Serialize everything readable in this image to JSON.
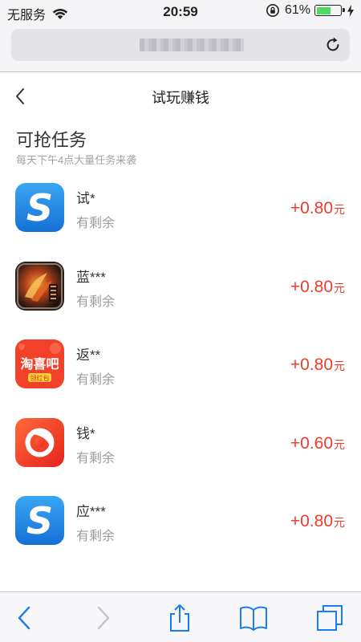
{
  "status_bar": {
    "carrier": "无服务",
    "time": "20:59",
    "battery_percent": "61%",
    "battery_level": 0.61
  },
  "browser": {
    "url": "",
    "reload_icon": "reload-icon"
  },
  "header": {
    "title": "试玩赚钱",
    "back_icon": "chevron-left-icon"
  },
  "section": {
    "title": "可抢任务",
    "subtitle": "每天下午4点大量任务来袭"
  },
  "tasks": [
    {
      "name": "试*",
      "remain": "有剩余",
      "reward": "+0.80",
      "unit": "元",
      "icon": "blue-s-app-icon"
    },
    {
      "name": "蓝***",
      "remain": "有剩余",
      "reward": "+0.80",
      "unit": "元",
      "icon": "game-app-icon"
    },
    {
      "name": "返**",
      "remain": "有剩余",
      "reward": "+0.80",
      "unit": "元",
      "icon": "taoxiba-app-icon"
    },
    {
      "name": "钱*",
      "remain": "有剩余",
      "reward": "+0.60",
      "unit": "元",
      "icon": "red-swirl-app-icon"
    },
    {
      "name": "应***",
      "remain": "有剩余",
      "reward": "+0.80",
      "unit": "元",
      "icon": "blue-s-app-icon"
    }
  ],
  "toolbar": {
    "back_icon": "back-arrow-icon",
    "forward_icon": "forward-arrow-icon",
    "share_icon": "share-icon",
    "bookmarks_icon": "bookmarks-icon",
    "tabs_icon": "tabs-icon"
  },
  "colors": {
    "accent_blue": "#1a7cf5",
    "reward_red": "#ee3b2c",
    "battery_green": "#4cd964"
  }
}
